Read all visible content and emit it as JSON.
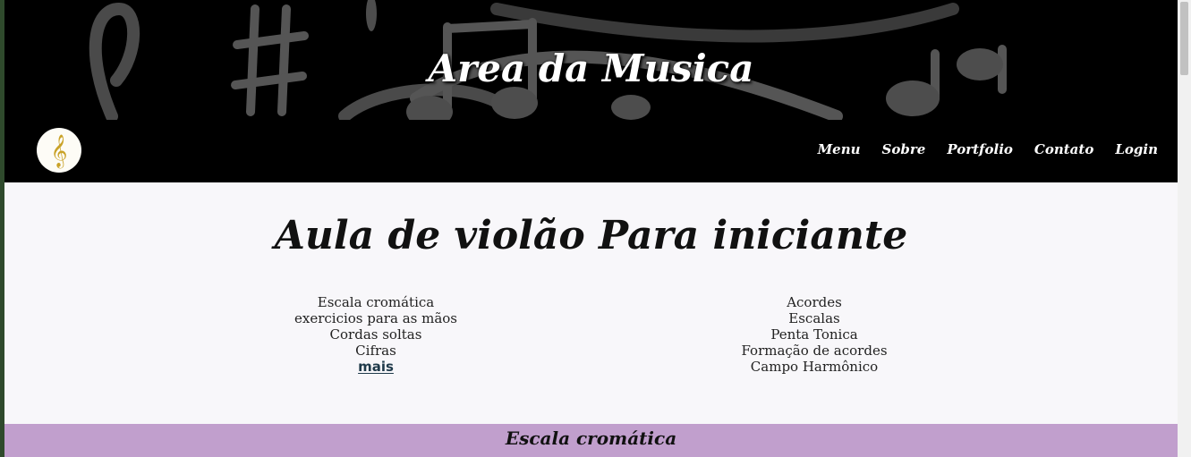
{
  "site": {
    "title": "Area da Musica",
    "logo_icon": "treble-clef-icon"
  },
  "nav": {
    "items": [
      {
        "label": "Menu"
      },
      {
        "label": "Sobre"
      },
      {
        "label": "Portfolio"
      },
      {
        "label": "Contato"
      },
      {
        "label": "Login"
      }
    ]
  },
  "main": {
    "title": "Aula de violão Para iniciante",
    "left_list": [
      "Escala cromática",
      "exercicios para as mãos",
      "Cordas soltas",
      "Cifras"
    ],
    "more_label": "mais",
    "right_list": [
      "Acordes",
      "Escalas",
      "Penta Tonica",
      "Formação de acordes",
      "Campo Harmônico"
    ]
  },
  "section": {
    "title": "Escala cromática",
    "color": "#c19fcd"
  }
}
